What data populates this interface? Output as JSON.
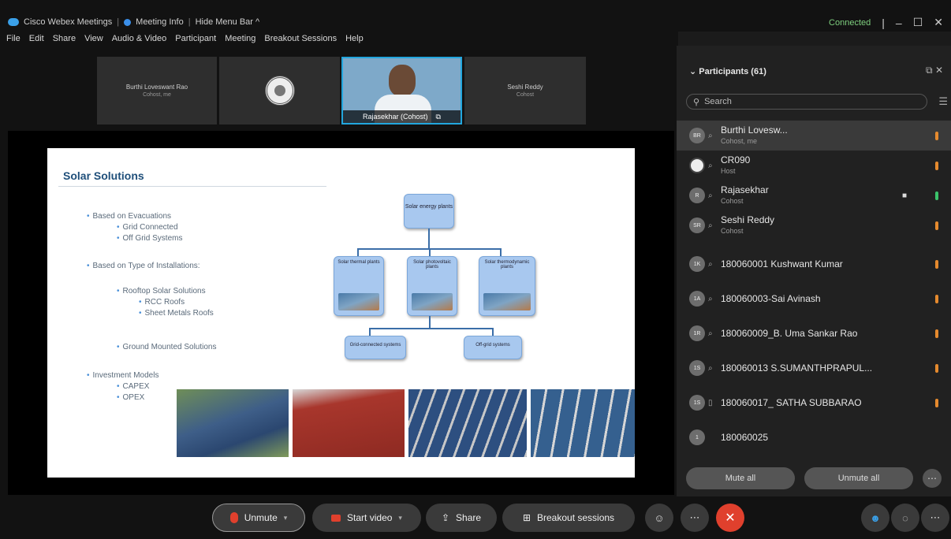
{
  "titlebar": {
    "app_name": "Cisco Webex Meetings",
    "meeting_info": "Meeting Info",
    "hide_menu": "Hide Menu Bar ^",
    "status": "Connected",
    "colors": {
      "accent": "#3aa0e8",
      "status": "#7fd07f"
    }
  },
  "menu": [
    "File",
    "Edit",
    "Share",
    "View",
    "Audio & Video",
    "Participant",
    "Meeting",
    "Breakout Sessions",
    "Help"
  ],
  "videos": [
    {
      "name": "Burthi Loveswant Rao",
      "sub": "Cohost, me"
    },
    {
      "name": "",
      "sub": ""
    },
    {
      "name": "Rajasekhar (Cohost)",
      "sub": ""
    },
    {
      "name": "Seshi Reddy",
      "sub": "Cohost"
    }
  ],
  "slide": {
    "title": "Solar Solutions",
    "bullets": [
      {
        "text": "Based on Evacuations",
        "level": 1
      },
      {
        "text": "Grid Connected",
        "level": 2
      },
      {
        "text": "Off Grid Systems",
        "level": 2
      },
      {
        "text": "Based on Type of Installations:",
        "level": 1
      },
      {
        "text": "Rooftop Solar Solutions",
        "level": 2
      },
      {
        "text": "RCC Roofs",
        "level": 3
      },
      {
        "text": "Sheet Metals Roofs",
        "level": 3
      },
      {
        "text": "Ground Mounted Solutions",
        "level": 2
      },
      {
        "text": "Investment Models",
        "level": 1
      },
      {
        "text": "CAPEX",
        "level": 2
      },
      {
        "text": "OPEX",
        "level": 2
      }
    ],
    "diagram": {
      "root": "Solar energy plants",
      "children": [
        "Solar thermal plants",
        "Solar photovoltaic plants",
        "Solar thermodynamic plants"
      ],
      "leaves": [
        "Grid-connected systems",
        "Off-grid systems"
      ]
    }
  },
  "panel": {
    "title": "Participants (61)",
    "search_placeholder": "Search",
    "mute_all": "Mute all",
    "unmute_all": "Unmute all",
    "participants": [
      {
        "initials": "BR",
        "name": "Burthi Lovesw...",
        "role": "Cohost, me",
        "mute": "orange",
        "selected": true
      },
      {
        "initials": "",
        "name": "CR090",
        "role": "Host",
        "mute": "orange",
        "seal": true
      },
      {
        "initials": "R",
        "name": "Rajasekhar",
        "role": "Cohost",
        "mute": "green",
        "cam": true
      },
      {
        "initials": "SR",
        "name": "Seshi Reddy",
        "role": "Cohost",
        "mute": "orange"
      },
      {
        "initials": "1K",
        "name": "180060001 Kushwant Kumar",
        "role": "",
        "mute": "orange"
      },
      {
        "initials": "1A",
        "name": "180060003-Sai Avinash",
        "role": "",
        "mute": "orange"
      },
      {
        "initials": "1R",
        "name": "180060009_B. Uma Sankar Rao",
        "role": "",
        "mute": "orange"
      },
      {
        "initials": "1S",
        "name": "180060013 S.SUMANTHPRAPUL...",
        "role": "",
        "mute": "orange"
      },
      {
        "initials": "1S",
        "name": "180060017_ SATHA SUBBARAO",
        "role": "",
        "mute": "orange"
      },
      {
        "initials": "1",
        "name": "180060025",
        "role": "",
        "mute": "none"
      }
    ]
  },
  "controls": {
    "unmute": "Unmute",
    "start_video": "Start video",
    "share": "Share",
    "breakout": "Breakout sessions",
    "end_color": "#e0402d"
  }
}
